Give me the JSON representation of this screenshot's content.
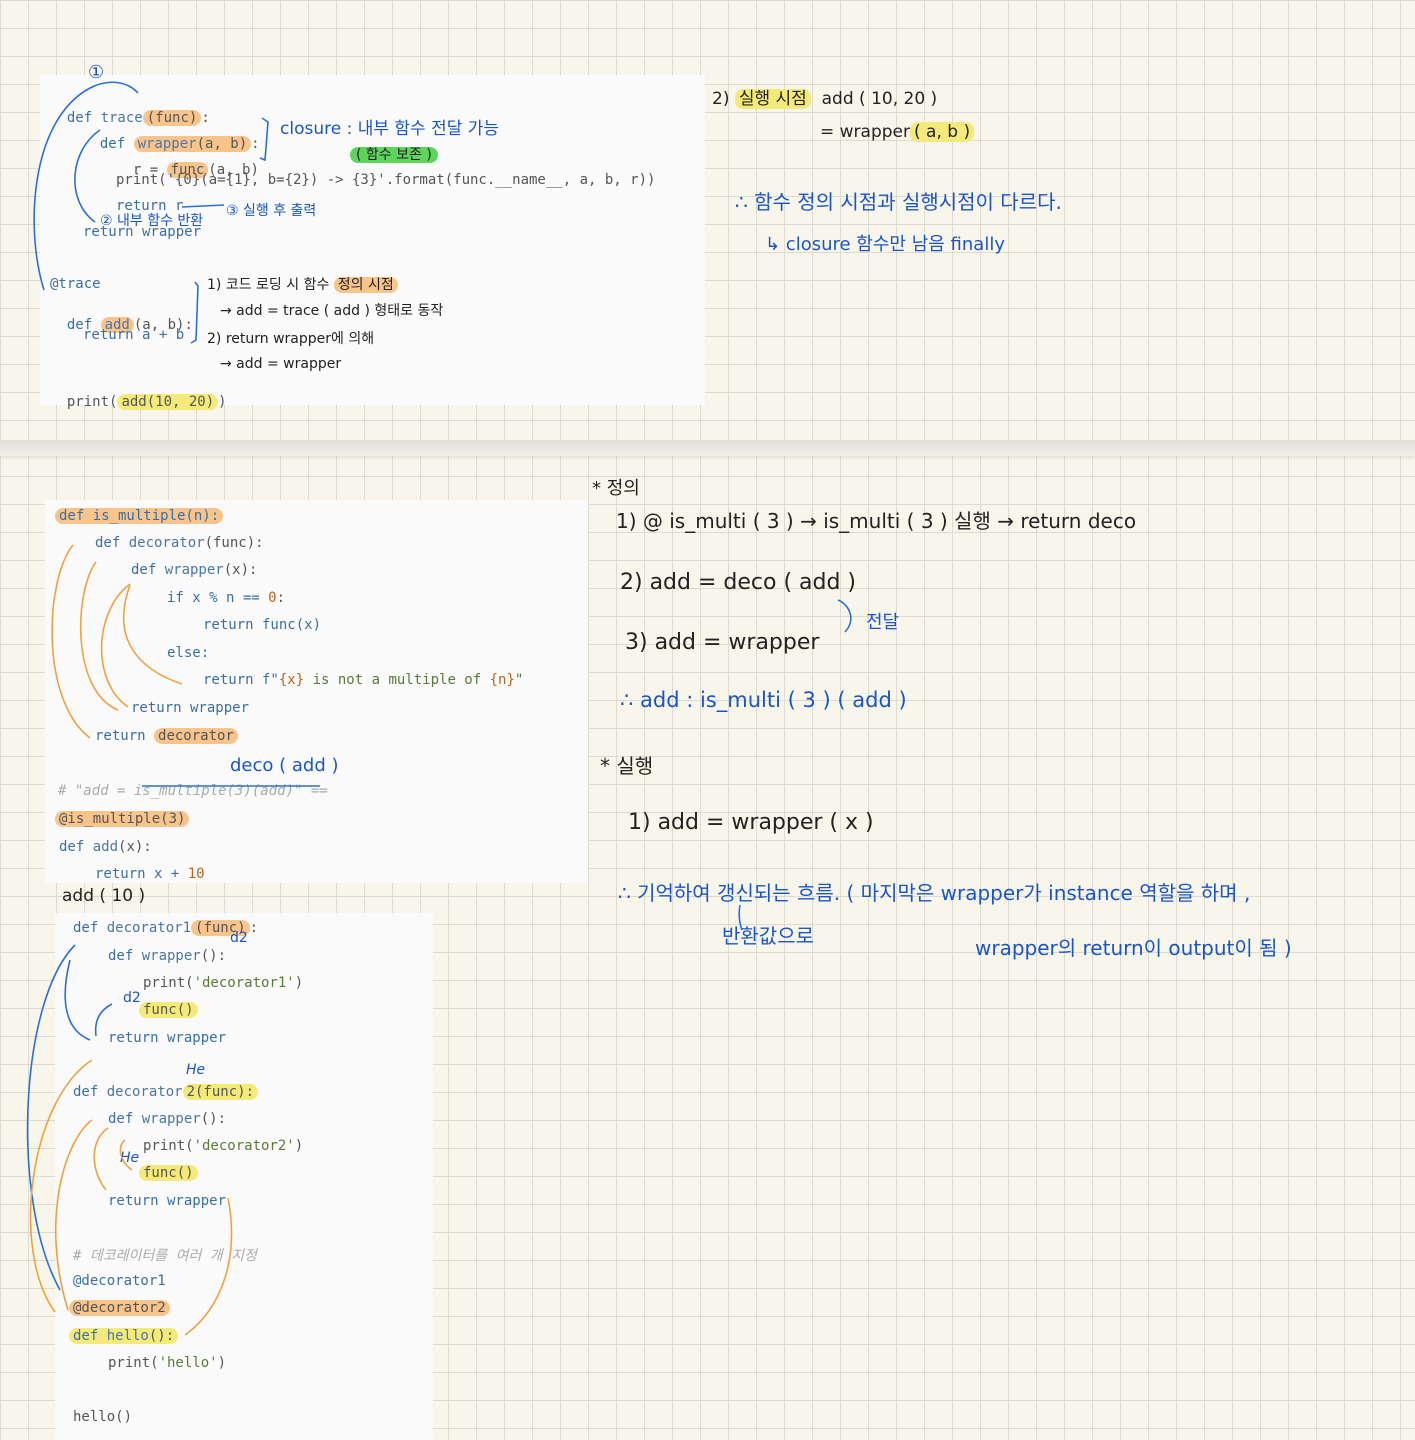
{
  "section1": {
    "circle_num": "①",
    "code": {
      "l1_def": "def ",
      "l1_fn": "trace",
      "l1_arg": "(func)",
      "l1_end": ":",
      "l2_def": "def ",
      "l2_fn": "wrapper",
      "l2_arg": "(a, b)",
      "l2_end": ":",
      "l3_pre": "r = ",
      "l3_fn": "func",
      "l3_post": "(a, b)",
      "l4": "print('{0}(a={1}, b={2}) -> {3}'.format(func.__name__, a, b, r))",
      "l5": "return r",
      "l6": "return wrapper",
      "l7": "@trace",
      "l8_def": "def ",
      "l8_fn": "add",
      "l8_post": "(a, b):",
      "l9": "return a + b",
      "l10_pre": "print(",
      "l10_hl": "add(10, 20)",
      "l10_post": ")"
    },
    "notes": {
      "closure": "closure : 내부 함수 전달 가능",
      "keep": "( 함수 보존 )",
      "inner_return": "② 내부 함수 반환",
      "exec_output": "③ 실행 후 출력",
      "n1_pre": "1) 코드 로딩 시 함수 ",
      "n1_hl": "정의 시점",
      "n2": "→ add = trace ( add ) 형태로 동작",
      "n3": "2) return wrapper에 의해",
      "n4": "→ add = wrapper"
    },
    "right": {
      "r1_num": "2)",
      "r1_hl": "실행 시점",
      "r1_post": "add ( 10, 20 )",
      "r2_pre": "= wrapper",
      "r2_hl": "( a, b )",
      "r3": "∴ 함수 정의 시점과 실행시점이 다르다.",
      "r4": "↳ closure 함수만 남음  finally"
    }
  },
  "section2": {
    "code": {
      "l1": "def is_multiple(n):",
      "l2_def": "def ",
      "l2_fn": "decorator",
      "l2_post": "(func):",
      "l3_def": "def ",
      "l3_fn": "wrapper",
      "l3_post": "(x):",
      "l4_pre": "if x % n == ",
      "l4_num": "0",
      "l4_post": ":",
      "l5": "return func(x)",
      "l6": "else:",
      "l7_pre": "return f\"",
      "l7_a": "{x}",
      "l7_mid": " is not a multiple of ",
      "l7_b": "{n}",
      "l7_post": "\"",
      "l8": "return wrapper",
      "l9_pre": "return ",
      "l9_hl": "decorator",
      "l10": "# \"add = is_multiple(3)(add)\" ==",
      "l11": "@is_multiple(3)",
      "l12_def": "def ",
      "l12_fn": "add",
      "l12_post": "(x):",
      "l13_pre": "return x + ",
      "l13_num": "10"
    },
    "deco_add": "deco ( add )",
    "add10": "add ( 10 )",
    "right": {
      "head": "* 정의",
      "d1": "1)  @ is_multi ( 3 )  →  is_multi ( 3 )  실행  →  return  deco",
      "d2": "2)  add  =  deco ( add )",
      "pass": "전달",
      "d3": "3) add  =  wrapper",
      "d4": "∴  add  :  is_multi ( 3 ) ( add )",
      "exec_head": "* 실행",
      "e1": "1)  add  =  wrapper ( x )",
      "c1": "∴  기억하여   갱신되는 흐름. ( 마지막은   wrapper가  instance 역할을  하며 ,",
      "c2": "반환값으로",
      "c3": "wrapper의   return이   output이  됨 )"
    }
  },
  "section3": {
    "code": {
      "l1_def": "def ",
      "l1_fn": "decorator1",
      "l1_hl": "(func)",
      "l1_end": ":",
      "l2_def": "def ",
      "l2_fn": "wrapper",
      "l2_post": "():",
      "l3_pre": "print(",
      "l3_str": "'decorator1'",
      "l3_post": ")",
      "l4": "func()",
      "l5": "return wrapper",
      "l6_def": "def ",
      "l6_fn": "decorator",
      "l6_hl": "2(func):",
      "l7_def": "def ",
      "l7_fn": "wrapper",
      "l7_post": "():",
      "l8_pre": "print(",
      "l8_str": "'decorator2'",
      "l8_post": ")",
      "l9": "func()",
      "l10": "return wrapper",
      "l11": "# 데코레이터를 여러 개 지정",
      "l12": "@decorator1",
      "l13": "@decorator2",
      "l14_def": "def ",
      "l14_fn": "hello",
      "l14_post": "():",
      "l15_pre": "print(",
      "l15_str": "'hello'",
      "l15_post": ")",
      "l16": "hello()"
    },
    "labels": {
      "d2_a": "d2",
      "d2_b": "d2",
      "he_a": "He",
      "he_b": "He"
    }
  },
  "colors": {
    "orange_highlight": "#f7c48c",
    "yellow_highlight": "#f4ea7a",
    "green_highlight": "#5ed45c",
    "ink_blue": "#1a55c8",
    "ink_orange": "#f0a040"
  }
}
